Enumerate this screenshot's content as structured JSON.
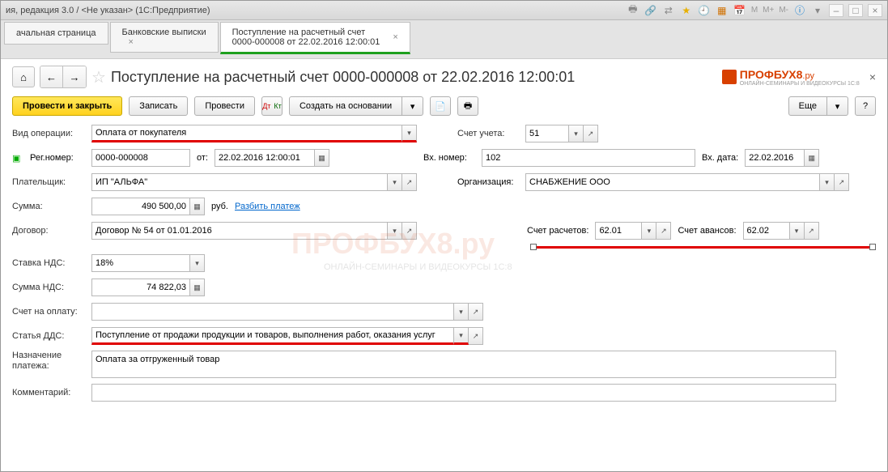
{
  "titlebar": "ия, редакция 3.0 / <Не указан>  (1С:Предприятие)",
  "titlebar_m": [
    "M",
    "M+",
    "M-"
  ],
  "tabs": [
    {
      "label": "ачальная страница"
    },
    {
      "label": "Банковские выписки"
    },
    {
      "label": "Поступление на расчетный счет",
      "sub": "0000-000008 от 22.02.2016 12:00:01"
    }
  ],
  "header": {
    "title": "Поступление на расчетный счет 0000-000008 от 22.02.2016 12:00:01",
    "logo": "ПРОФБУХ8",
    "logo_suffix": ".ру",
    "logo_sub": "ОНЛАЙН-СЕМИНАРЫ И ВИДЕОКУРСЫ 1С:8"
  },
  "toolbar": {
    "post_close": "Провести и закрыть",
    "save": "Записать",
    "post": "Провести",
    "create_based": "Создать на основании",
    "more": "Еще"
  },
  "form": {
    "op_type_label": "Вид операции:",
    "op_type": "Оплата от покупателя",
    "account_label": "Счет учета:",
    "account": "51",
    "reg_num_label": "Рег.номер:",
    "reg_num": "0000-000008",
    "date_label": "от:",
    "date": "22.02.2016 12:00:01",
    "in_num_label": "Вх. номер:",
    "in_num": "102",
    "in_date_label": "Вх. дата:",
    "in_date": "22.02.2016",
    "payer_label": "Плательщик:",
    "payer": "ИП \"АЛЬФА\"",
    "org_label": "Организация:",
    "org": "СНАБЖЕНИЕ ООО",
    "sum_label": "Сумма:",
    "sum": "490 500,00",
    "currency": "руб.",
    "split_link": "Разбить платеж",
    "contract_label": "Договор:",
    "contract": "Договор № 54 от 01.01.2016",
    "acc_calc_label": "Счет расчетов:",
    "acc_calc": "62.01",
    "acc_advance_label": "Счет авансов:",
    "acc_advance": "62.02",
    "vat_rate_label": "Ставка НДС:",
    "vat_rate": "18%",
    "vat_sum_label": "Сумма НДС:",
    "vat_sum": "74 822,03",
    "invoice_label": "Счет на оплату:",
    "invoice": "",
    "dds_label": "Статья ДДС:",
    "dds": "Поступление от продажи продукции и товаров, выполнения работ, оказания услуг",
    "purpose_label": "Назначение платежа:",
    "purpose": "Оплата за отгруженный товар",
    "comment_label": "Комментарий:",
    "comment": ""
  },
  "watermark": "ПРОФБУХ8.ру",
  "watermark_sub": "ОНЛАЙН-СЕМИНАРЫ И ВИДЕОКУРСЫ 1С:8"
}
